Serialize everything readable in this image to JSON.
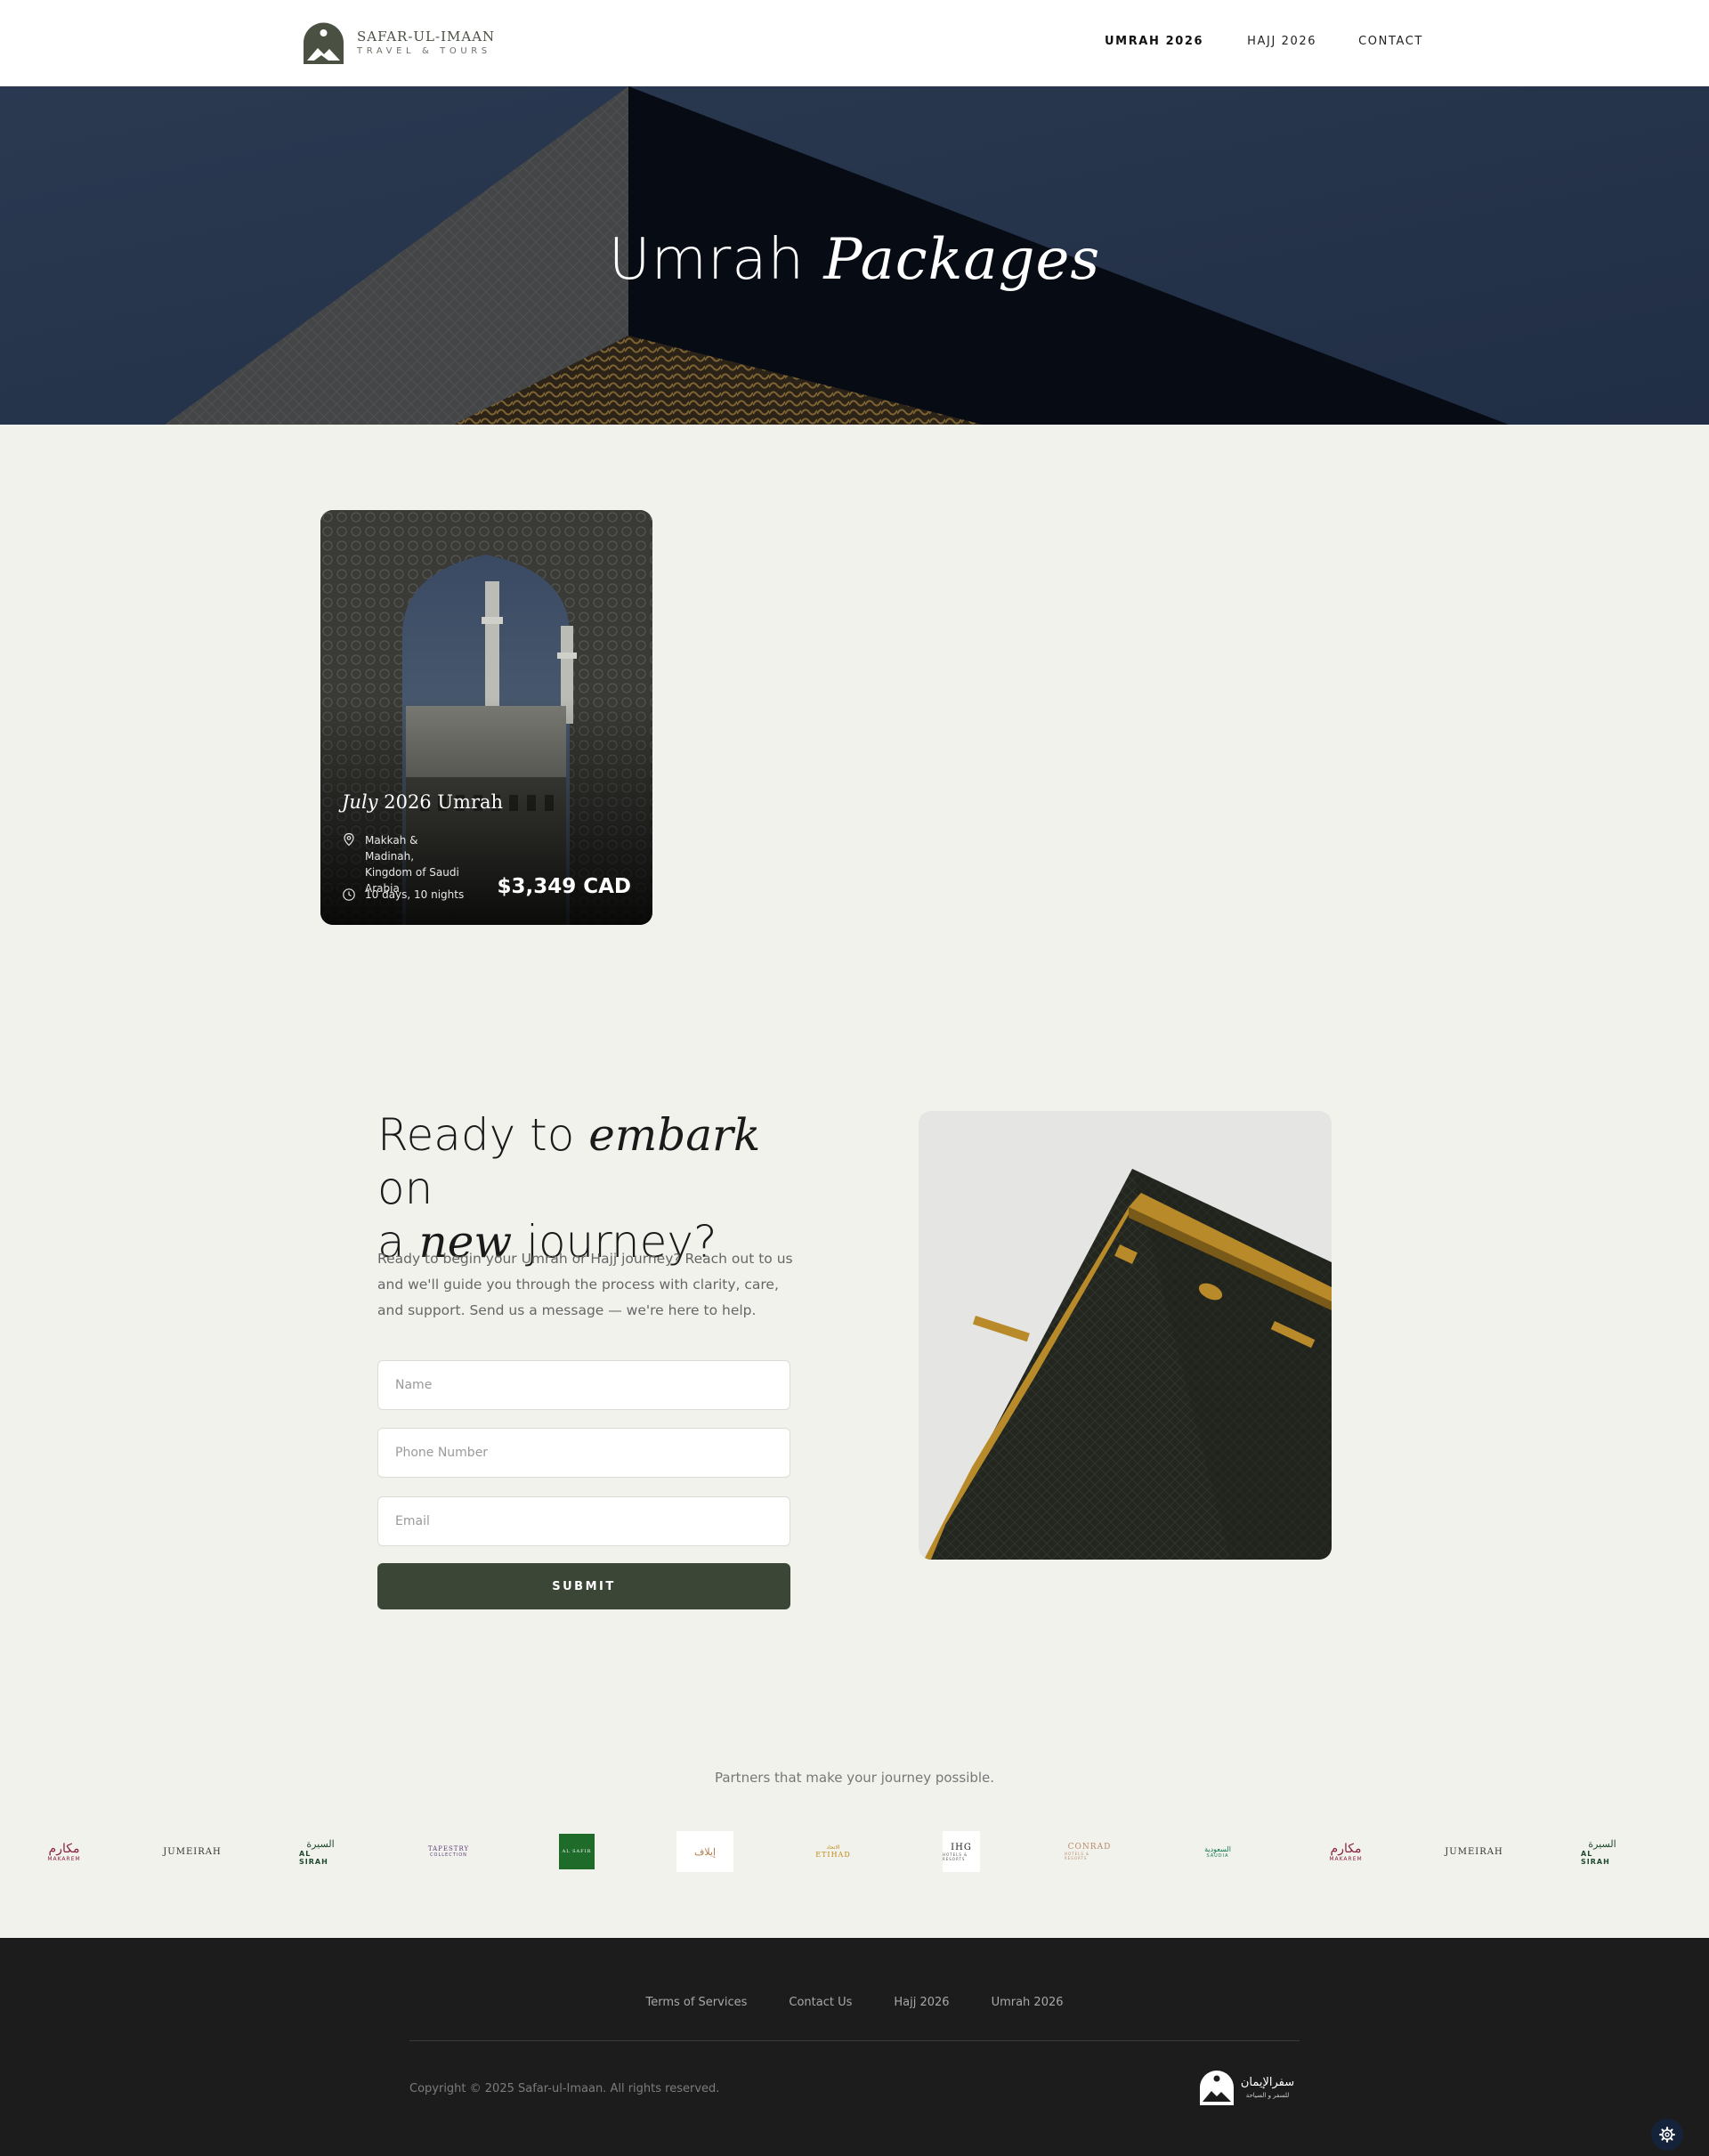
{
  "header": {
    "logo_name": "SAFAR-UL-IMAAN",
    "logo_tagline": "TRAVEL & TOURS",
    "nav": [
      {
        "label": "UMRAH 2026",
        "active": true
      },
      {
        "label": "HAJJ 2026",
        "active": false
      },
      {
        "label": "CONTACT",
        "active": false
      }
    ]
  },
  "hero": {
    "title_plain": "Umrah",
    "title_italic": "Packages"
  },
  "package_card": {
    "title_italic": "July",
    "title_rest": "2026 Umrah",
    "location": "Makkah & Madinah, Kingdom of Saudi Arabia",
    "duration": "10 days, 10 nights",
    "price": "$3,349 CAD",
    "icons": [
      "map-pin-icon",
      "clock-icon"
    ]
  },
  "cta": {
    "title_1": "Ready to",
    "title_2": "embark",
    "title_3": "on",
    "title_4": "a",
    "title_5": "new",
    "title_6": "journey?",
    "description": "Ready to begin your Umrah or Hajj journey? Reach out to us and we'll guide you through the process with clarity, care, and support. Send us a message — we're here to help.",
    "name_placeholder": "Name",
    "phone_placeholder": "Phone Number",
    "email_placeholder": "Email",
    "submit_label": "SUBMIT"
  },
  "partners": {
    "title": "Partners that make your journey possible.",
    "logos": [
      {
        "name": "Makarem",
        "text": "مكارم",
        "sub": "MAKAREM",
        "color": "#8b1f3f"
      },
      {
        "name": "Jumeirah",
        "text": "JUMEIRAH",
        "sub": "",
        "color": "#333333"
      },
      {
        "name": "Al Sirah",
        "text": "السيرة",
        "sub": "AL SIRAH",
        "color": "#1f4a2f"
      },
      {
        "name": "Tapestry",
        "text": "TAPESTRY",
        "sub": "COLLECTION",
        "color": "#5a3a7a"
      },
      {
        "name": "Al Safir",
        "text": "AL SAFIR",
        "sub": "",
        "color": "#1e6b2a"
      },
      {
        "name": "Elaf",
        "text": "إيلاف",
        "sub": "",
        "color": "#b07b4a"
      },
      {
        "name": "Etihad",
        "text": "ETIHAD",
        "sub": "الاتحاد",
        "color": "#bd8b13"
      },
      {
        "name": "IHG",
        "text": "IHG",
        "sub": "HOTELS & RESORTS",
        "color": "#222222"
      },
      {
        "name": "Conrad",
        "text": "CONRAD",
        "sub": "HOTELS & RESORTS",
        "color": "#b98a6a"
      },
      {
        "name": "Saudia",
        "text": "السعودية",
        "sub": "SAUDIA",
        "color": "#0f7a4a"
      },
      {
        "name": "Makarem 2",
        "text": "مكارم",
        "sub": "MAKAREM",
        "color": "#8b1f3f"
      },
      {
        "name": "Jumeirah 2",
        "text": "JUMEIRAH",
        "sub": "",
        "color": "#333333"
      },
      {
        "name": "Al Sirah 2",
        "text": "السيرة",
        "sub": "AL SIRAH",
        "color": "#1f4a2f"
      }
    ]
  },
  "footer": {
    "links": [
      "Terms of Services",
      "Contact Us",
      "Hajj 2026",
      "Umrah 2026"
    ],
    "copyright": "Copyright © 2025 Safar-ul-Imaan. All rights reserved.",
    "logo_arabic": "سفرالإيمان",
    "logo_arabic_sub": "للسفر و السياحة"
  },
  "colors": {
    "accent": "#3c4637",
    "footer_bg": "#1c1c1c",
    "page_bg": "#f2f2ed"
  }
}
